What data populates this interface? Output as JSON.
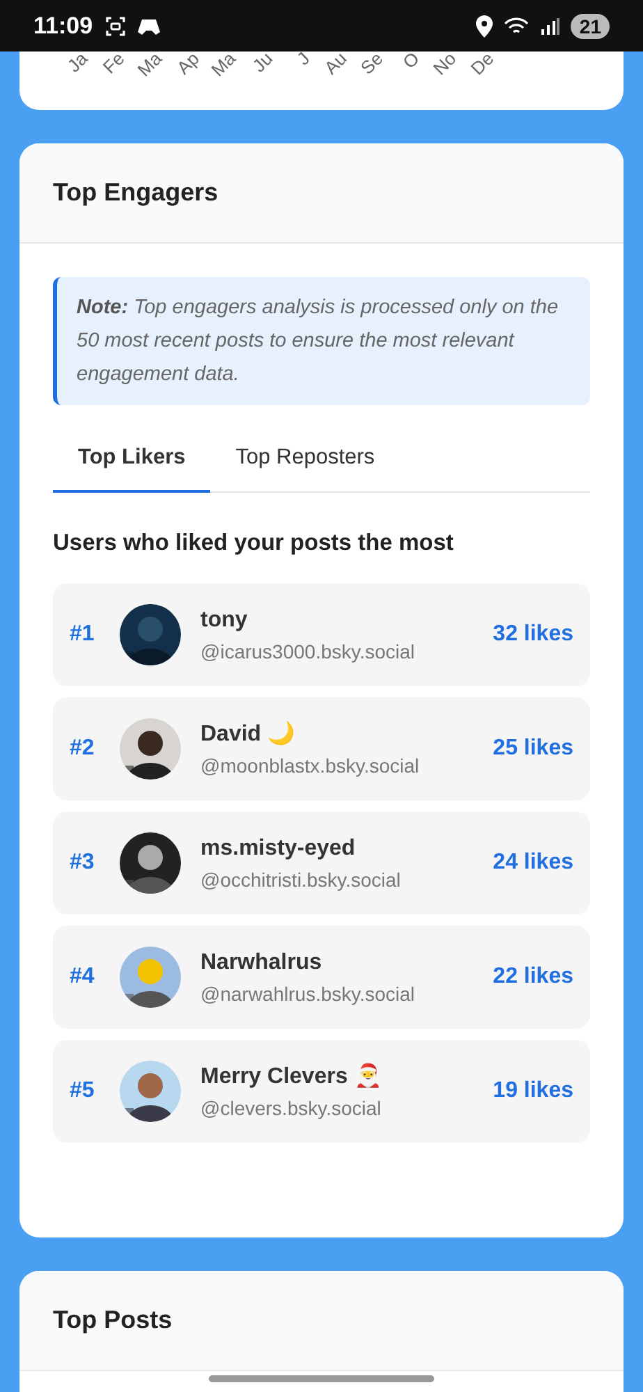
{
  "status_bar": {
    "time": "11:09",
    "battery": "21"
  },
  "chart_card": {
    "axis_labels": [
      "Ja",
      "Fe",
      "Ma",
      "Ap",
      "Ma",
      "Ju",
      "J",
      "Au",
      "Se",
      "O",
      "No",
      "De"
    ]
  },
  "engagers_card": {
    "title": "Top Engagers",
    "note": "**Note:** Top engagers analysis is processed only on the 50 most recent posts to ensure the most relevant engagement data.",
    "tabs": [
      {
        "label": "Top Likers",
        "selected": true
      },
      {
        "label": "Top Reposters",
        "selected": false
      }
    ],
    "subtitle": "Users who liked your posts the most",
    "users": [
      {
        "rank": "#1",
        "name": "tony",
        "handle": "@icarus3000.bsky.social",
        "count": "32 likes"
      },
      {
        "rank": "#2",
        "name": "David 🌙",
        "handle": "@moonblastx.bsky.social",
        "count": "25 likes"
      },
      {
        "rank": "#3",
        "name": "ms.misty-eyed",
        "handle": "@occhitristi.bsky.social",
        "count": "24 likes"
      },
      {
        "rank": "#4",
        "name": "Narwhalrus",
        "handle": "@narwahlrus.bsky.social",
        "count": "22 likes"
      },
      {
        "rank": "#5",
        "name": "Merry Clevers 🎅",
        "handle": "@clevers.bsky.social",
        "count": "19 likes"
      }
    ]
  },
  "posts_card": {
    "title": "Top Posts"
  }
}
